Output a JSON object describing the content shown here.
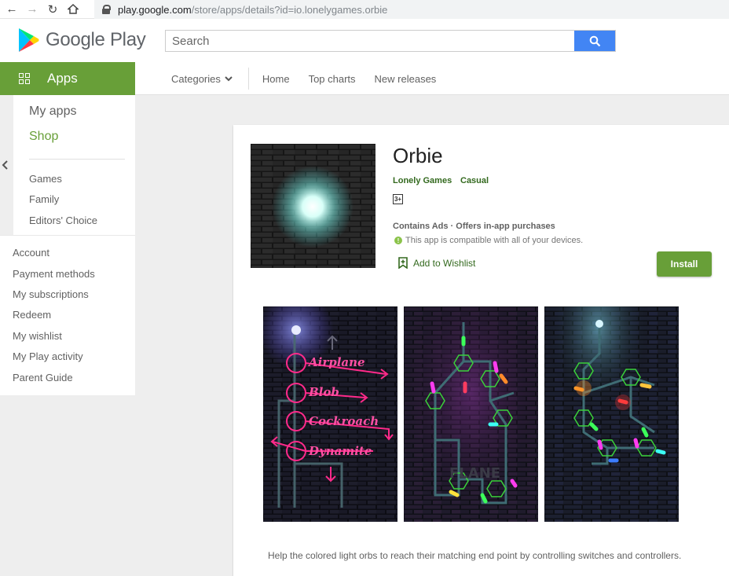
{
  "browser": {
    "url_host": "play.google.com",
    "url_path": "/store/apps/details?id=io.lonelygames.orbie"
  },
  "header": {
    "logo_text": "Google Play",
    "search_placeholder": "Search"
  },
  "subnav": {
    "section": "Apps",
    "categories_label": "Categories",
    "links": [
      "Home",
      "Top charts",
      "New releases"
    ]
  },
  "sidebar": {
    "my_apps": "My apps",
    "shop": "Shop",
    "sub_items": [
      "Games",
      "Family",
      "Editors' Choice"
    ],
    "account_items": [
      "Account",
      "Payment methods",
      "My subscriptions",
      "Redeem",
      "My wishlist",
      "My Play activity",
      "Parent Guide"
    ]
  },
  "app": {
    "title": "Orbie",
    "developer": "Lonely Games",
    "genre": "Casual",
    "rating_badge": "3+",
    "ads_info": "Contains Ads · Offers in-app purchases",
    "compat_text": "This app is compatible with all of your devices.",
    "wishlist_label": "Add to Wishlist",
    "install_label": "Install",
    "screenshot1_labels": [
      "Airplane",
      "Blob",
      "Cockroach",
      "Dynamite"
    ],
    "screenshot2_label": "FLANE",
    "description": "Help the colored light orbs to reach their matching end point by controlling switches and controllers."
  },
  "colors": {
    "play_green": "#689f38",
    "dark_green": "#33691e",
    "search_blue": "#4285f4",
    "neon_pink": "#ff2a8a"
  }
}
